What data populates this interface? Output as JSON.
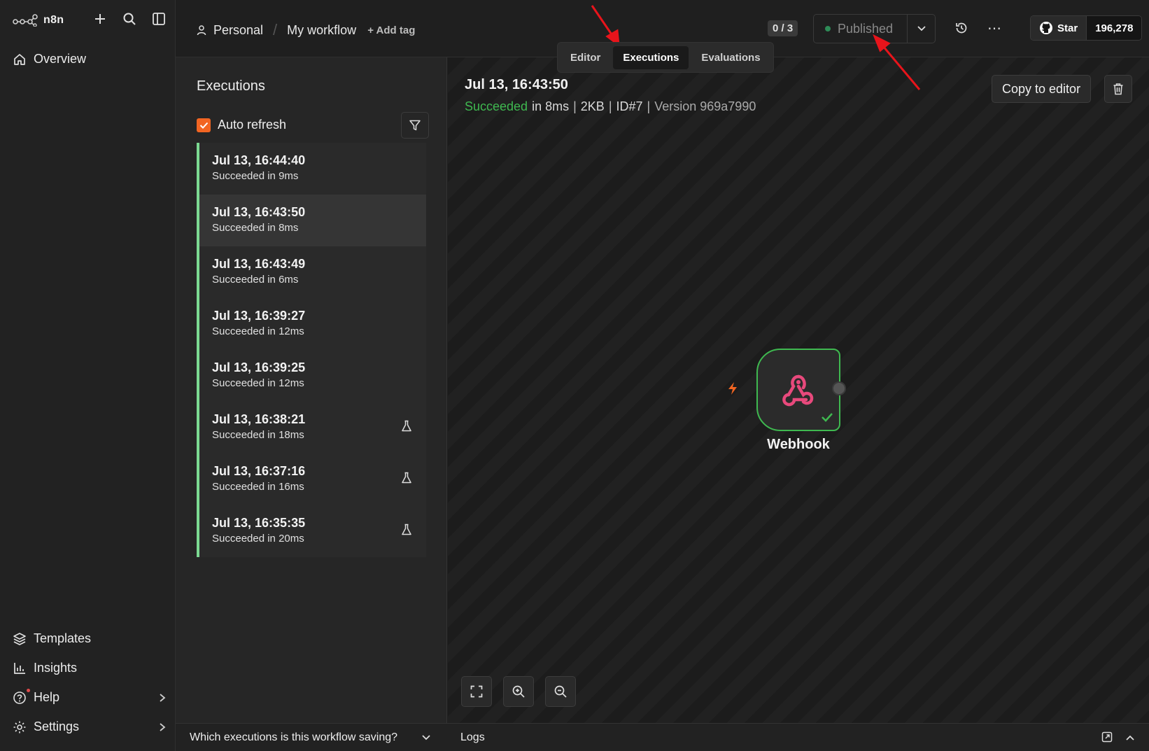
{
  "app": {
    "logo_text": "n8n"
  },
  "sidebar": {
    "overview": "Overview",
    "templates": "Templates",
    "insights": "Insights",
    "help": "Help",
    "settings": "Settings"
  },
  "header": {
    "project": "Personal",
    "workflow_name": "My workflow",
    "add_tag": "+ Add tag",
    "counter": "0 / 3",
    "publish_label": "Published",
    "github_star": "Star",
    "github_count": "196,278"
  },
  "tabs": {
    "editor": "Editor",
    "executions": "Executions",
    "evaluations": "Evaluations"
  },
  "executions_panel": {
    "title": "Executions",
    "auto_refresh": "Auto refresh",
    "items": [
      {
        "time": "Jul 13, 16:44:40",
        "status": "Succeeded in 9ms"
      },
      {
        "time": "Jul 13, 16:43:50",
        "status": "Succeeded in 8ms"
      },
      {
        "time": "Jul 13, 16:43:49",
        "status": "Succeeded in 6ms"
      },
      {
        "time": "Jul 13, 16:39:27",
        "status": "Succeeded in 12ms"
      },
      {
        "time": "Jul 13, 16:39:25",
        "status": "Succeeded in 12ms"
      },
      {
        "time": "Jul 13, 16:38:21",
        "status": "Succeeded in 18ms"
      },
      {
        "time": "Jul 13, 16:37:16",
        "status": "Succeeded in 16ms"
      },
      {
        "time": "Jul 13, 16:35:35",
        "status": "Succeeded in 20ms"
      }
    ],
    "bottom_question": "Which executions is this workflow saving?"
  },
  "execution_detail": {
    "date": "Jul 13, 16:43:50",
    "status": "Succeeded",
    "duration": "in 8ms",
    "size": "2KB",
    "id": "ID#7",
    "version": "Version 969a7990",
    "copy_button": "Copy to editor",
    "node_label": "Webhook"
  },
  "logs": {
    "label": "Logs"
  },
  "colors": {
    "accent": "#f26522",
    "success": "#3fb950",
    "list_border": "#7cd992",
    "annotation": "#e8141b"
  }
}
